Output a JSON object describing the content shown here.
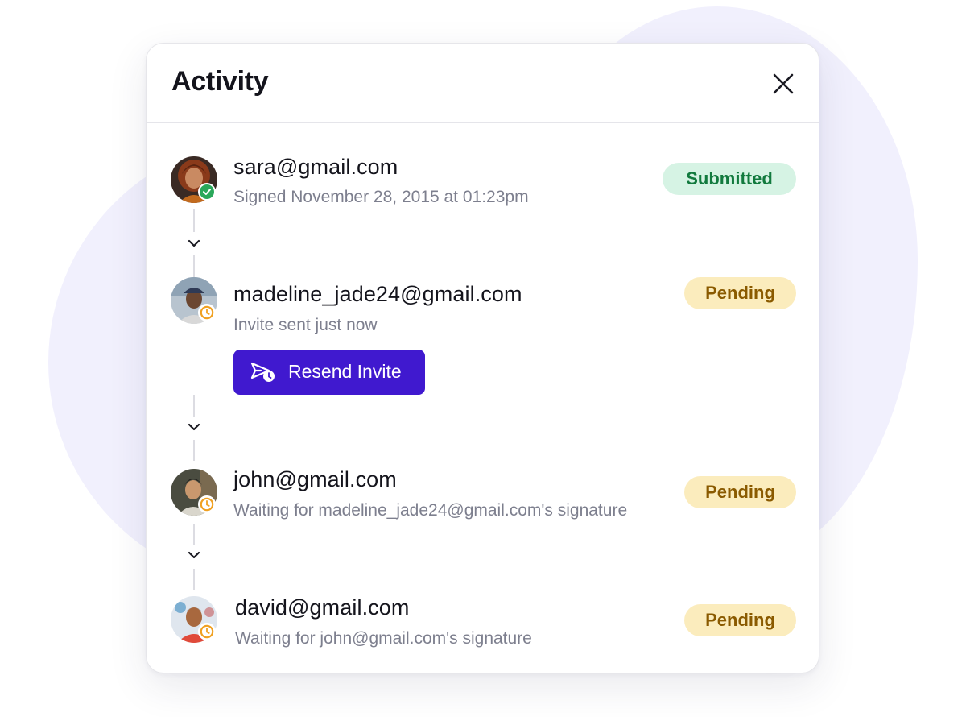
{
  "panel": {
    "title": "Activity"
  },
  "entries": [
    {
      "email": "sara@gmail.com",
      "detail": "Signed November 28, 2015 at 01:23pm",
      "status": "Submitted",
      "indicator": "check-icon"
    },
    {
      "email": "madeline_jade24@gmail.com",
      "detail": "Invite sent just now",
      "status": "Pending",
      "indicator": "clock-icon",
      "action": "Resend Invite"
    },
    {
      "email": "john@gmail.com",
      "detail": "Waiting for madeline_jade24@gmail.com's signature",
      "status": "Pending",
      "indicator": "clock-icon"
    },
    {
      "email": "david@gmail.com",
      "detail": "Waiting for john@gmail.com's signature",
      "status": "Pending",
      "indicator": "clock-icon"
    }
  ],
  "colors": {
    "accent": "#4019cf",
    "submitted_bg": "#d6f3e4",
    "submitted_text": "#127a3e",
    "pending_bg": "#fbecbd",
    "pending_text": "#8a5a00",
    "background_blob": "#f1f0fd"
  }
}
